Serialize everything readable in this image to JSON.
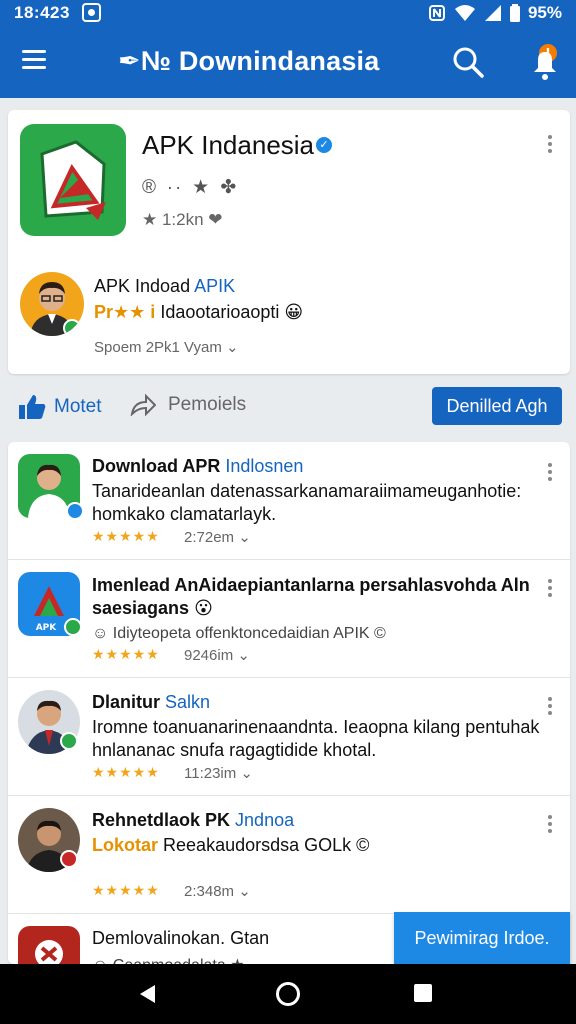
{
  "status_bar": {
    "time": "18:423",
    "battery": "95%"
  },
  "app_bar": {
    "title": "✒№ Downindanasia"
  },
  "app_card": {
    "name": "APK Indanesia",
    "meta_icons": "® ∙∙ ★ ✤",
    "stats": "★ 1:2kn ❤",
    "author": {
      "name_prefix": "APK Indoad",
      "name_highlight": "APIK",
      "desc_highlight": "Pr★★ i",
      "desc": "Idaootarioaopti 😀",
      "footer": "Spoem  2Pk1 Vyam  ⌄"
    }
  },
  "actions": {
    "like_label": "Motet",
    "share_label": "Pemoiels",
    "download_label": "Denilled Agh"
  },
  "list": {
    "items": [
      {
        "name": "Download APR",
        "name_highlight": "Indlosnen",
        "desc_highlight": "",
        "desc": "Tanarideanlan datenassarkanamaraiimameuganhotie: homkako clamatarlayk.",
        "rating": "★★★★★",
        "meta": "2:72em  ⌄"
      },
      {
        "name": "Imenlead AnAidaepiantanlarna persahlasvohda Aln saesiagans 😮",
        "name_highlight": "",
        "desc_highlight": "",
        "desc": "☺ Idiyteopeta offenktoncedaidian APIK ©",
        "rating": "★★★★★",
        "meta": "9246im  ⌄"
      },
      {
        "name": "Dlanitur",
        "name_highlight": "Salkn",
        "desc_highlight": "",
        "desc": "Iromne toanuanarinenaandnta. Ieaopna kilang pentuhak hnlananac snufa ragagtidide khotal.",
        "rating": "★★★★★",
        "meta": "11:23im  ⌄"
      },
      {
        "name": "Rehnetdlaok PK",
        "name_highlight": "Jndnoa",
        "desc_highlight": "Lokotar",
        "desc": "Reeakaudorsdsa GOLk ©",
        "rating": "★★★★★",
        "meta": "2:348m  ⌄"
      },
      {
        "name": "Demlovalinokan. Gtan",
        "name_highlight": "",
        "desc_highlight": "",
        "desc": "☺ Ceanmoadalata ★",
        "rating": "",
        "meta": ""
      }
    ]
  },
  "floating_button": {
    "label": "Pewimirag Irdoe."
  },
  "colors": {
    "primary": "#1565c0",
    "accent": "#1e88e5",
    "star": "#f2a51a",
    "app_icon_green": "#2aa84a"
  }
}
